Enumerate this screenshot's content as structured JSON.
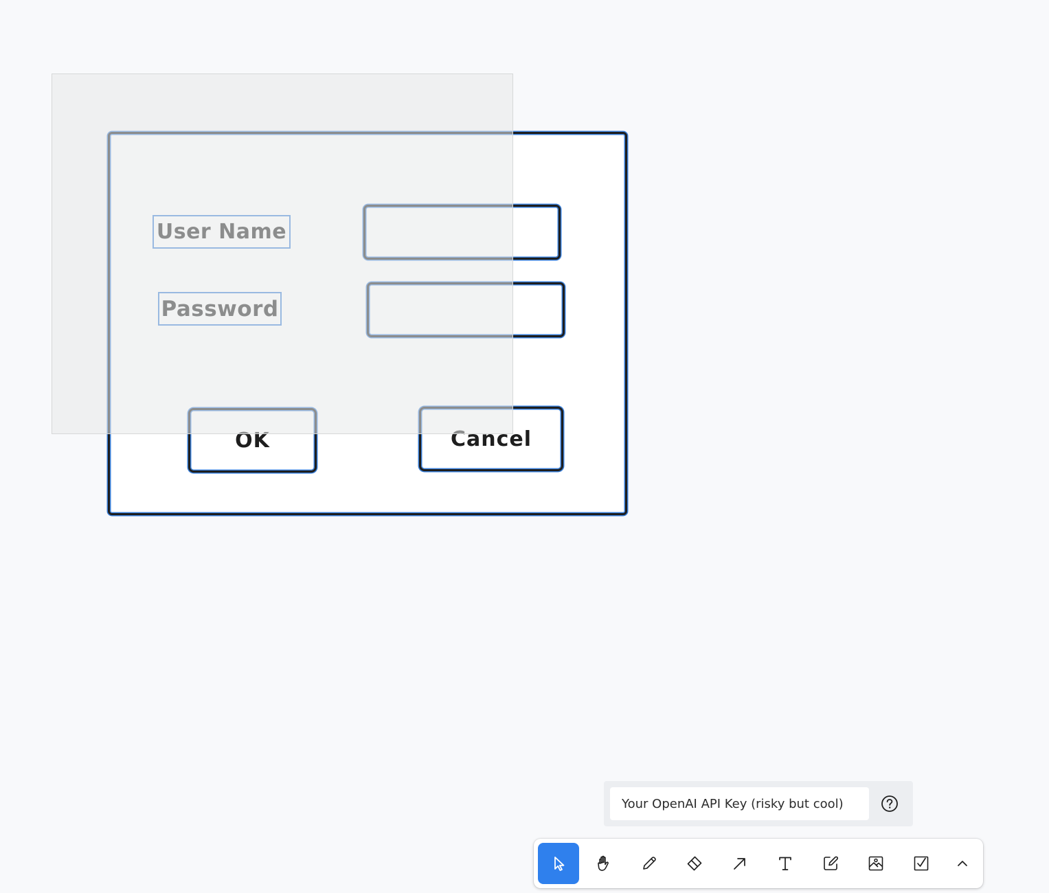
{
  "canvas": {
    "labels": {
      "username": "User Name",
      "password": "Password"
    },
    "buttons": {
      "ok": "OK",
      "cancel": "Cancel"
    }
  },
  "api_key": {
    "placeholder": "Your OpenAI API Key (risky but cool)"
  },
  "toolbar": {
    "active_tool": "select",
    "tools": [
      {
        "name": "select",
        "icon": "pointer-icon"
      },
      {
        "name": "hand",
        "icon": "hand-icon"
      },
      {
        "name": "draw",
        "icon": "pencil-icon"
      },
      {
        "name": "eraser",
        "icon": "eraser-icon"
      },
      {
        "name": "arrow",
        "icon": "arrow-icon"
      },
      {
        "name": "text",
        "icon": "text-icon"
      },
      {
        "name": "note",
        "icon": "note-icon"
      },
      {
        "name": "asset",
        "icon": "image-icon"
      },
      {
        "name": "checkbox",
        "icon": "checkbox-icon"
      },
      {
        "name": "more",
        "icon": "chevron-up-icon"
      }
    ]
  },
  "colors": {
    "background": "#f8f9fb",
    "stroke": "#1e1e1e",
    "selection": "#3a7fd8",
    "active_tool": "#2f80ed"
  }
}
